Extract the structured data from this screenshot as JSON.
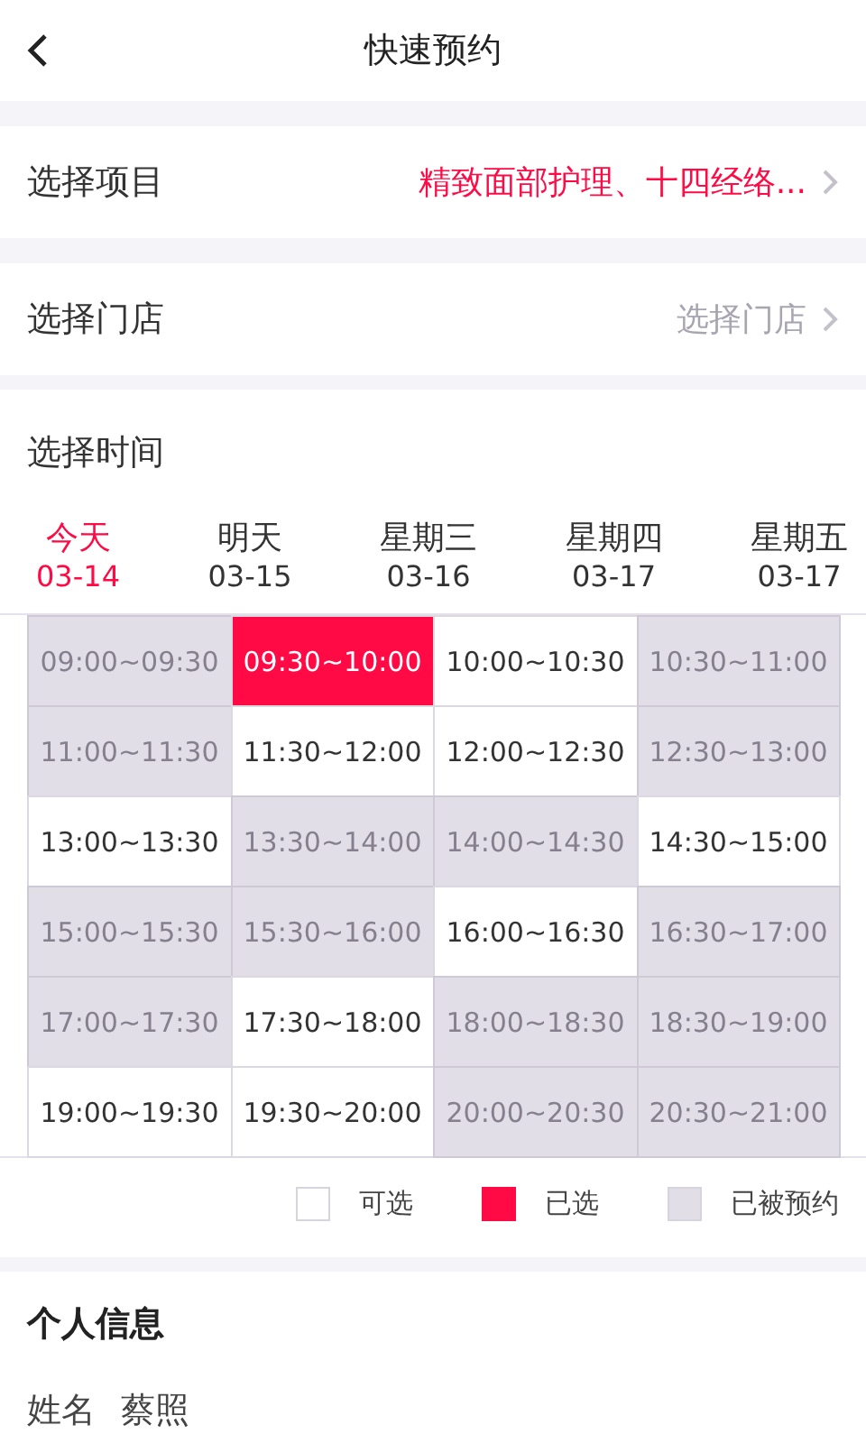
{
  "header": {
    "title": "快速预约"
  },
  "project": {
    "label": "选择项目",
    "value": "精致面部护理、十四经络...",
    "placeholder": false
  },
  "store": {
    "label": "选择门店",
    "value": "选择门店",
    "placeholder": true
  },
  "time": {
    "title": "选择时间",
    "days": [
      {
        "name": "今天",
        "date": "03-14",
        "selected": true
      },
      {
        "name": "明天",
        "date": "03-15",
        "selected": false
      },
      {
        "name": "星期三",
        "date": "03-16",
        "selected": false
      },
      {
        "name": "星期四",
        "date": "03-17",
        "selected": false
      },
      {
        "name": "星期五",
        "date": "03-17",
        "selected": false
      }
    ],
    "slots": [
      {
        "label": "09:00~09:30",
        "booked": true,
        "selected": false
      },
      {
        "label": "09:30~10:00",
        "booked": false,
        "selected": true
      },
      {
        "label": "10:00~10:30",
        "booked": false,
        "selected": false
      },
      {
        "label": "10:30~11:00",
        "booked": true,
        "selected": false
      },
      {
        "label": "11:00~11:30",
        "booked": true,
        "selected": false
      },
      {
        "label": "11:30~12:00",
        "booked": false,
        "selected": false
      },
      {
        "label": "12:00~12:30",
        "booked": false,
        "selected": false
      },
      {
        "label": "12:30~13:00",
        "booked": true,
        "selected": false
      },
      {
        "label": "13:00~13:30",
        "booked": false,
        "selected": false
      },
      {
        "label": "13:30~14:00",
        "booked": true,
        "selected": false
      },
      {
        "label": "14:00~14:30",
        "booked": true,
        "selected": false
      },
      {
        "label": "14:30~15:00",
        "booked": false,
        "selected": false
      },
      {
        "label": "15:00~15:30",
        "booked": true,
        "selected": false
      },
      {
        "label": "15:30~16:00",
        "booked": true,
        "selected": false
      },
      {
        "label": "16:00~16:30",
        "booked": false,
        "selected": false
      },
      {
        "label": "16:30~17:00",
        "booked": true,
        "selected": false
      },
      {
        "label": "17:00~17:30",
        "booked": true,
        "selected": false
      },
      {
        "label": "17:30~18:00",
        "booked": false,
        "selected": false
      },
      {
        "label": "18:00~18:30",
        "booked": true,
        "selected": false
      },
      {
        "label": "18:30~19:00",
        "booked": true,
        "selected": false
      },
      {
        "label": "19:00~19:30",
        "booked": false,
        "selected": false
      },
      {
        "label": "19:30~20:00",
        "booked": false,
        "selected": false
      },
      {
        "label": "20:00~20:30",
        "booked": true,
        "selected": false
      },
      {
        "label": "20:30~21:00",
        "booked": true,
        "selected": false
      }
    ],
    "legend": [
      {
        "label": "可选",
        "kind": "free"
      },
      {
        "label": "已选",
        "kind": "selected"
      },
      {
        "label": "已被预约",
        "kind": "booked"
      }
    ]
  },
  "personal": {
    "title": "个人信息",
    "name_label": "姓名",
    "name_value": "蔡照"
  }
}
